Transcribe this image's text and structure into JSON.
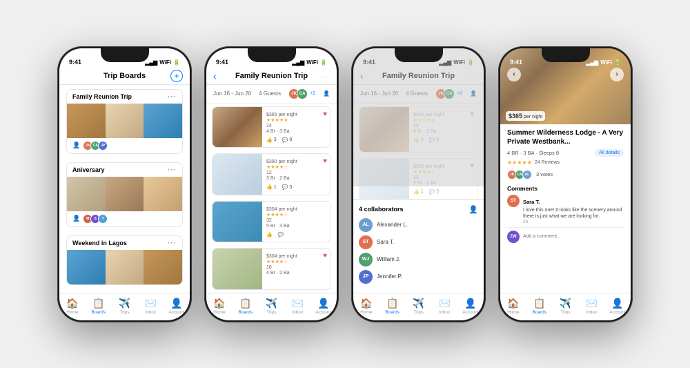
{
  "phones": [
    {
      "id": "phone1",
      "status_time": "9:41",
      "header_title": "Trip Boards",
      "has_add_btn": true,
      "boards": [
        {
          "title": "Family Reunion Trip",
          "images": [
            "img-house1",
            "img-house2",
            "img-pool1"
          ],
          "avatars": [
            {
              "initials": "JK",
              "color": "#e07050"
            },
            {
              "initials": "CA",
              "color": "#50a070"
            },
            {
              "initials": "JP",
              "color": "#5070d0"
            }
          ]
        },
        {
          "title": "Aniversary",
          "images": [
            "img-house3",
            "img-room1",
            "img-room2"
          ],
          "avatars": [
            {
              "initials": "M",
              "color": "#d06050"
            },
            {
              "initials": "S",
              "color": "#7050d0"
            },
            {
              "initials": "T",
              "color": "#50a0d0"
            }
          ]
        },
        {
          "title": "Weekend in Lagos",
          "images": [
            "img-pool1",
            "img-house2",
            "img-house1"
          ],
          "avatars": []
        }
      ],
      "tabs": [
        {
          "icon": "🏠",
          "label": "Home",
          "active": false
        },
        {
          "icon": "📋",
          "label": "Boards",
          "active": true
        },
        {
          "icon": "✈️",
          "label": "Trips",
          "active": false
        },
        {
          "icon": "✉️",
          "label": "Inbox",
          "active": false
        },
        {
          "icon": "👤",
          "label": "Account",
          "active": false
        }
      ]
    },
    {
      "id": "phone2",
      "status_time": "9:41",
      "header_title": "Family Reunion Trip",
      "has_back": true,
      "trip_dates": "Jun 16 - Jun 20",
      "trip_guests": "4 Guests",
      "trip_avatars": [
        {
          "initials": "JK",
          "color": "#e07050"
        },
        {
          "initials": "CA",
          "color": "#50a070"
        }
      ],
      "trip_plus": "+2",
      "listings": [
        {
          "price": "$365",
          "per_night": " per night",
          "stars": "★★★★★",
          "reviews": "24",
          "br": "4 Br · 3 Ba",
          "img": "img-listing1",
          "likes": "3",
          "comments": "8",
          "hearted": true
        },
        {
          "price": "$390",
          "per_night": " per night",
          "stars": "★★★★☆",
          "reviews": "12",
          "br": "3 Br · 2 Ba",
          "img": "img-listing2",
          "likes": "1",
          "comments": "3",
          "hearted": true
        },
        {
          "price": "$304",
          "per_night": " per night",
          "stars": "★★★★☆",
          "reviews": "32",
          "br": "5 Br · 3 Ba",
          "img": "img-listing3",
          "likes": "",
          "comments": "",
          "hearted": false
        },
        {
          "price": "$304",
          "per_night": " per night",
          "stars": "★★★★☆",
          "reviews": "18",
          "br": "4 Br · 2 Ba",
          "img": "img-listing4",
          "likes": "",
          "comments": "",
          "hearted": true
        }
      ],
      "tabs": [
        {
          "icon": "🏠",
          "label": "Home",
          "active": false
        },
        {
          "icon": "📋",
          "label": "Boards",
          "active": true
        },
        {
          "icon": "✈️",
          "label": "Trips",
          "active": false
        },
        {
          "icon": "✉️",
          "label": "Inbox",
          "active": false
        },
        {
          "icon": "👤",
          "label": "Account",
          "active": false
        }
      ]
    },
    {
      "id": "phone3",
      "status_time": "9:41",
      "header_title": "Family Reunion Trip",
      "has_back": true,
      "trip_dates": "Jun 16 - Jun 20",
      "trip_guests": "4 Guests",
      "trip_avatars": [
        {
          "initials": "JK",
          "color": "#e07050"
        },
        {
          "initials": "CA",
          "color": "#50a070"
        }
      ],
      "trip_plus": "+2",
      "listings": [
        {
          "price": "$365",
          "per_night": " per night",
          "stars": "★★★★★",
          "reviews": "24",
          "br": "4 Br · 3 Ba",
          "img": "img-listing1",
          "likes": "3",
          "comments": "5",
          "hearted": true
        },
        {
          "price": "$390",
          "per_night": " per night",
          "stars": "★★★★☆",
          "reviews": "12",
          "br": "3 Br · 2 Ba",
          "img": "img-listing2",
          "likes": "1",
          "comments": "5",
          "hearted": true
        }
      ],
      "collaborators": [
        {
          "initials": "AL",
          "name": "Alexander L.",
          "color": "#6b9ed2"
        },
        {
          "initials": "ST",
          "name": "Sara T.",
          "color": "#e07050"
        },
        {
          "initials": "WJ",
          "name": "William J.",
          "color": "#50a070"
        },
        {
          "initials": "JP",
          "name": "Jennifer P.",
          "color": "#5070d0"
        }
      ],
      "collab_count": "4 collaborators",
      "tabs": [
        {
          "icon": "🏠",
          "label": "Home",
          "active": false
        },
        {
          "icon": "📋",
          "label": "Boards",
          "active": true
        },
        {
          "icon": "✈️",
          "label": "Trips",
          "active": false
        },
        {
          "icon": "✉️",
          "label": "Inbox",
          "active": false
        },
        {
          "icon": "👤",
          "label": "Account",
          "active": false
        }
      ]
    },
    {
      "id": "phone4",
      "status_time": "9:41",
      "detail": {
        "price": "$365",
        "per_night": "per night",
        "title": "Summer Wilderness Lodge - A Very Private Westbank...",
        "specs": "4 BR · 3 BA · Sleeps 8",
        "reviews_count": "24 Reviews",
        "stars": "★★★★★",
        "all_details_btn": "All details",
        "votes_text": "3 votes",
        "comments_title": "Comments",
        "comments": [
          {
            "author": "Sara T.",
            "text": "I love this one! It looks like the scenery around there is just what we are looking for.",
            "time": "2h",
            "initials": "ST",
            "color": "#e07050"
          }
        ],
        "add_comment_placeholder": "Add a comment...",
        "commenter_initials": "ZW",
        "commenter_color": "#7050d0",
        "vote_avatars": [
          {
            "initials": "JK",
            "color": "#e07050"
          },
          {
            "initials": "CA",
            "color": "#50a070"
          },
          {
            "initials": "AL",
            "color": "#6b9ed2"
          }
        ]
      },
      "tabs": [
        {
          "icon": "🏠",
          "label": "Home",
          "active": false
        },
        {
          "icon": "📋",
          "label": "Boards",
          "active": true
        },
        {
          "icon": "✈️",
          "label": "Trips",
          "active": false
        },
        {
          "icon": "✉️",
          "label": "Inbox",
          "active": false
        },
        {
          "icon": "👤",
          "label": "Account",
          "active": false
        }
      ]
    }
  ]
}
